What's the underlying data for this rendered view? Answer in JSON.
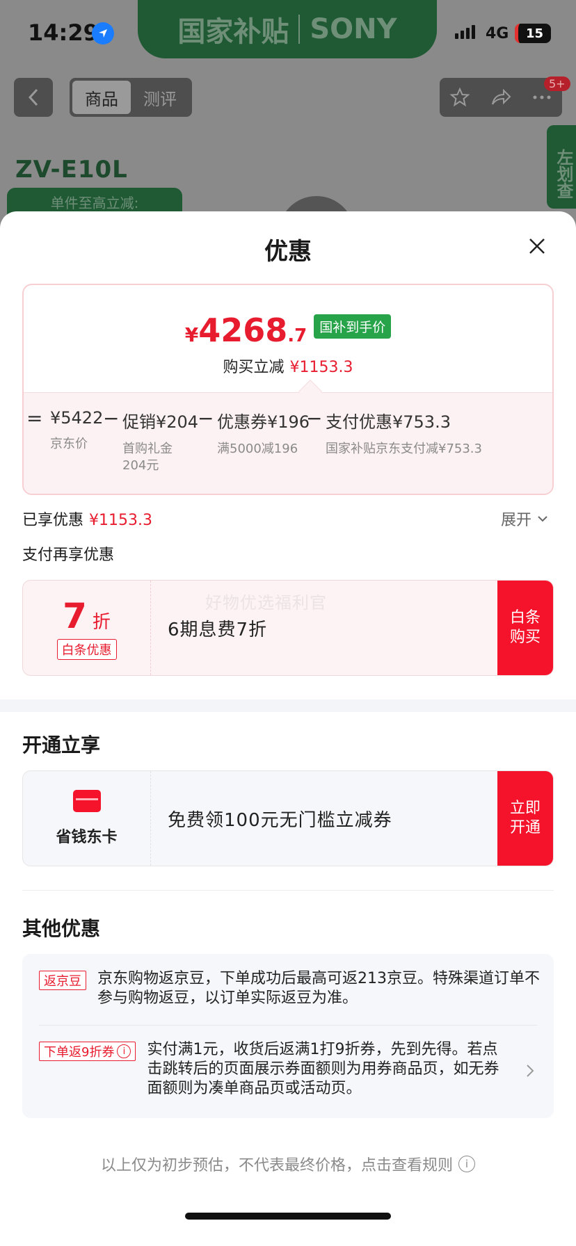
{
  "status_bar": {
    "time": "14:29",
    "network": "4G",
    "battery": "15"
  },
  "background": {
    "banner_left": "国家补贴",
    "banner_right": "SONY",
    "tabs": [
      "商品",
      "测评"
    ],
    "badge": "5+",
    "model": "ZV-E10L",
    "promo_text": "单件至高立减:",
    "side_text": "左划查"
  },
  "sheet": {
    "title": "优惠",
    "price": {
      "currency": "¥",
      "integer": "4268",
      "decimal": ".7",
      "tag": "国补到手价",
      "reduce_label": "购买立减",
      "reduce_amount": "¥1153.3"
    },
    "breakdown": {
      "equals": "=",
      "minus": "−",
      "items": [
        {
          "value": "¥5422",
          "sub": "京东价"
        },
        {
          "value": "促销¥204",
          "sub": "首购礼金\n204元"
        },
        {
          "value": "优惠券¥196",
          "sub": "满5000减196"
        },
        {
          "value": "支付优惠¥753.3",
          "sub": "国家补贴京东支付减¥753.3"
        }
      ]
    },
    "enjoyed_label": "已享优惠",
    "enjoyed_amount": "¥1153.3",
    "expand_label": "展开",
    "pay_label": "支付再享优惠",
    "baitiao": {
      "discount_num": "7",
      "discount_unit": "折",
      "tag": "白条优惠",
      "watermark": "好物优选福利官",
      "desc": "6期息费7折",
      "button": "白条购买"
    },
    "open_title": "开通立享",
    "card_offer": {
      "label": "省钱东卡",
      "desc": "免费领100元无门槛立减券",
      "button": "立即开通"
    },
    "other_title": "其他优惠",
    "others": [
      {
        "tag": "返京豆",
        "text": "京东购物返京豆，下单成功后最高可返213京豆。特殊渠道订单不参与购物返豆，以订单实际返豆为准。"
      },
      {
        "tag": "下单返9折券",
        "text": "实付满1元，收货后返满1打9折券，先到先得。若点击跳转后的页面展示券面额则为用券商品页，如无券面额则为凑单商品页或活动页。"
      }
    ],
    "footer": "以上仅为初步预估，不代表最终价格，点击查看规则"
  }
}
